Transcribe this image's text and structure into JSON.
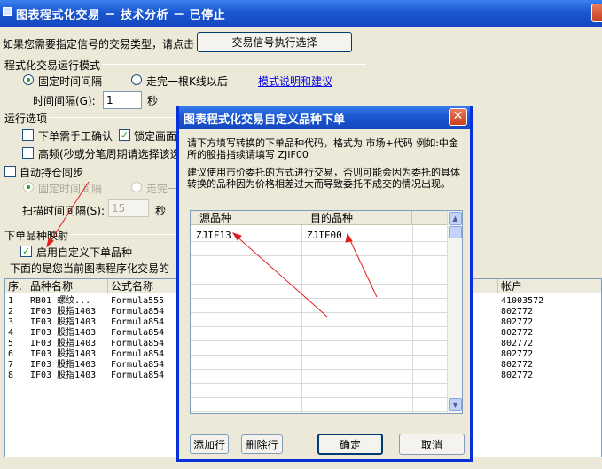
{
  "main_window": {
    "title": "图表程式化交易 － 技术分析 － 已停止",
    "signal_prompt": "如果您需要指定信号的交易类型，请点击",
    "signal_button": "交易信号执行选择",
    "run_mode_group": "程式化交易运行模式",
    "mode_fixed_interval": "固定时间间隔",
    "mode_after_kline": "走完一根K线以后",
    "mode_help_link": "模式说明和建议",
    "interval_label": "时间间隔(G):",
    "interval_value": "1",
    "interval_unit": "秒",
    "run_options_group": "运行选项",
    "opt_manual_confirm": "下单需手工确认",
    "opt_lock_screen": "锁定画面",
    "opt_high_freq": "高频(秒或分笔周期请选择该选",
    "auto_sync": "自动持仓同步",
    "sync_fixed_interval": "固定时间间隔",
    "sync_after": "走完一",
    "scan_interval_label": "扫描时间间隔(S):",
    "scan_interval_value": "15",
    "scan_unit": "秒",
    "order_map_group": "下单品种映射",
    "enable_custom": "启用自定义下单品种",
    "list_caption": "下面的是您当前图表程序化交易的",
    "table": {
      "headers": [
        "序.",
        "品种名称",
        "公式名称",
        "帐户"
      ],
      "rows": [
        {
          "no": "1",
          "name": "RB01 螺纹...",
          "formula": "Formula555",
          "account": "41003572"
        },
        {
          "no": "2",
          "name": "IF03 股指1403",
          "formula": "Formula854",
          "account": "802772"
        },
        {
          "no": "3",
          "name": "IF03 股指1403",
          "formula": "Formula854",
          "account": "802772"
        },
        {
          "no": "4",
          "name": "IF03 股指1403",
          "formula": "Formula854",
          "account": "802772"
        },
        {
          "no": "5",
          "name": "IF03 股指1403",
          "formula": "Formula854",
          "account": "802772"
        },
        {
          "no": "6",
          "name": "IF03 股指1403",
          "formula": "Formula854",
          "account": "802772"
        },
        {
          "no": "7",
          "name": "IF03 股指1403",
          "formula": "Formula854",
          "account": "802772"
        },
        {
          "no": "8",
          "name": "IF03 股指1403",
          "formula": "Formula854",
          "account": "802772"
        }
      ]
    }
  },
  "dialog": {
    "title": "图表程式化交易自定义品种下单",
    "desc1": "请下方填写转换的下单品种代码，格式为 市场+代码 例如:中金所的股指指续请填写 ZJIF00",
    "desc2": "建议使用市价委托的方式进行交易，否则可能会因为委托的具体转换的品种因为价格相差过大而导致委托不成交的情况出现。",
    "grid_headers": [
      "源品种",
      "目的品种"
    ],
    "grid_row": {
      "source": "ZJIF13",
      "target": "ZJIF00"
    },
    "btn_add": "添加行",
    "btn_delete": "删除行",
    "btn_ok": "确定",
    "btn_cancel": "取消"
  },
  "colors": {
    "title_blue": "#1a58d2",
    "annotation_red": "#e02020"
  }
}
